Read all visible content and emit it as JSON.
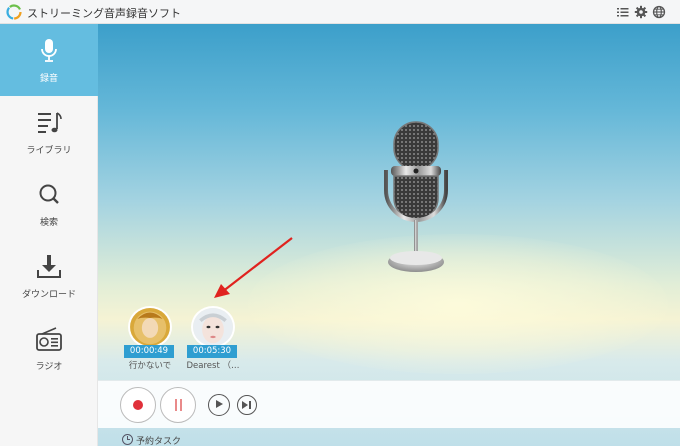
{
  "app": {
    "title": "ストリーミング音声録音ソフト"
  },
  "titlebar_icons": [
    "menu-list-icon",
    "gear-icon",
    "globe-icon"
  ],
  "sidebar": {
    "items": [
      {
        "label": "録音",
        "icon": "microphone-icon",
        "active": true
      },
      {
        "label": "ライブラリ",
        "icon": "music-list-icon",
        "active": false
      },
      {
        "label": "検索",
        "icon": "search-icon",
        "active": false
      },
      {
        "label": "ダウンロード",
        "icon": "download-icon",
        "active": false
      },
      {
        "label": "ラジオ",
        "icon": "radio-icon",
        "active": false
      }
    ]
  },
  "tracks": [
    {
      "duration": "00:00:49",
      "name": "行かないで"
    },
    {
      "duration": "00:05:30",
      "name": "Dearest （…"
    }
  ],
  "controls": {
    "buttons": [
      "record-button",
      "pause-button",
      "play-button",
      "next-button"
    ]
  },
  "schedule": {
    "label": "予約タスク"
  },
  "colors": {
    "accent": "#64bde0",
    "duration_badge": "#2f9ed1",
    "record_red": "#e0303a",
    "annotation_arrow": "#e0231f"
  }
}
